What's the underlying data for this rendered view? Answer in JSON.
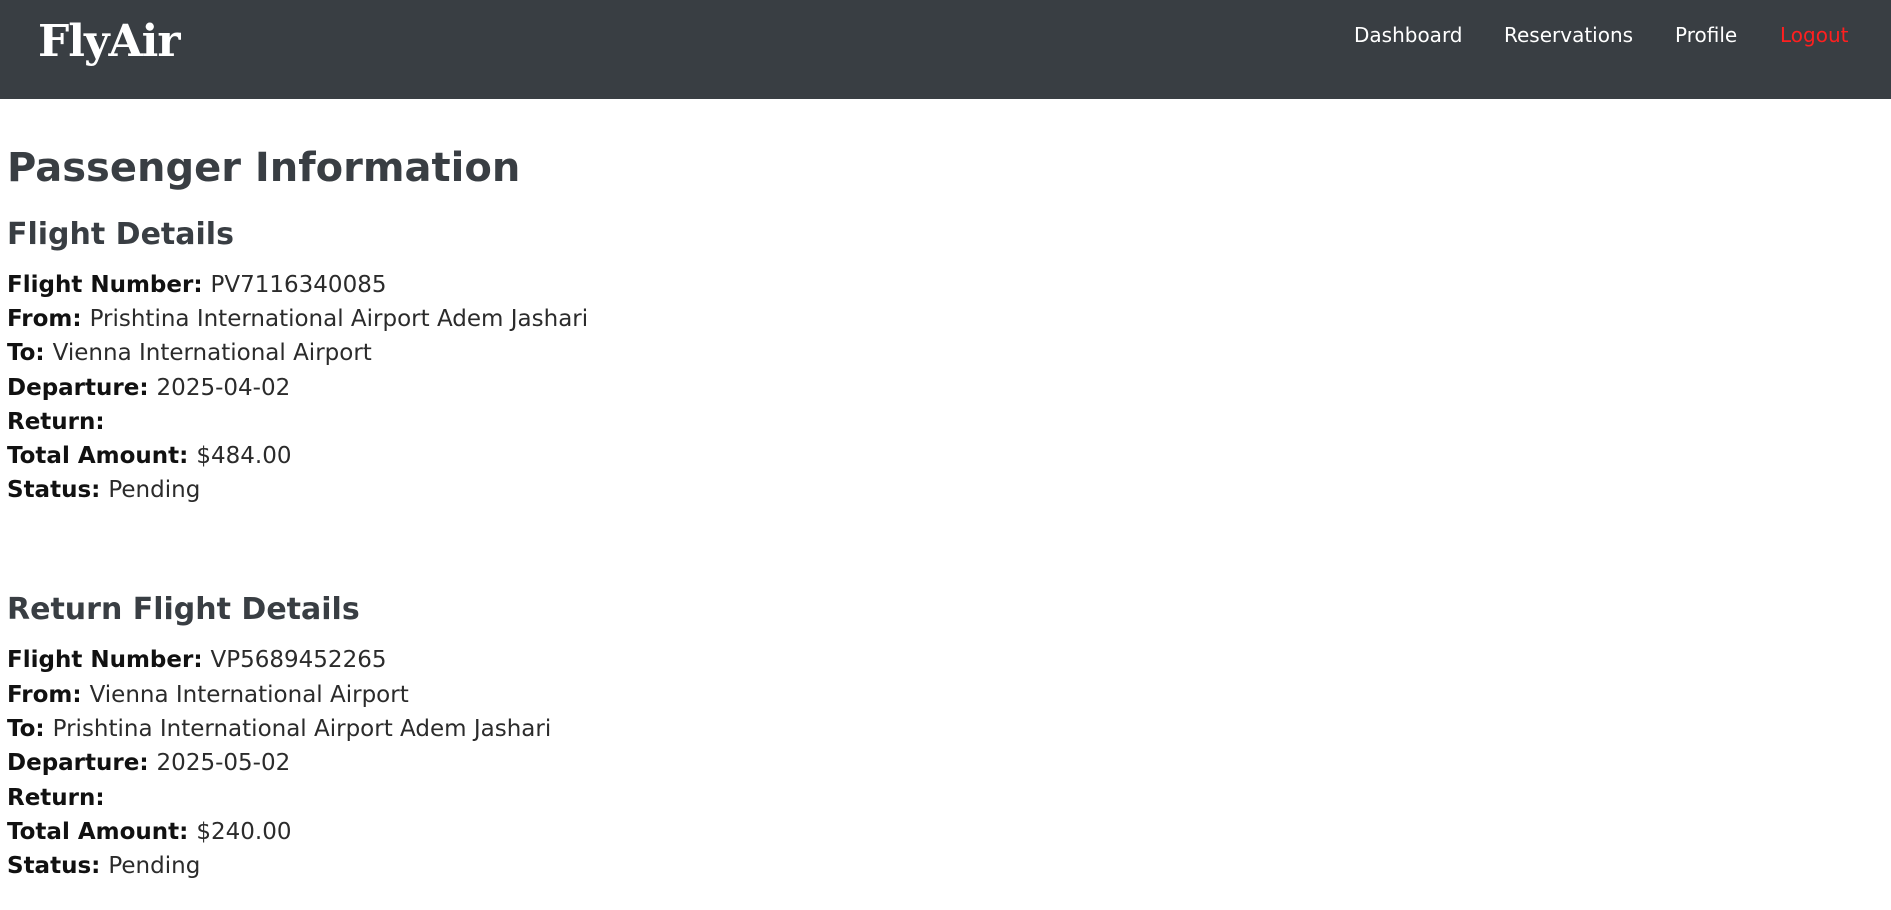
{
  "header": {
    "brand": "FlyAir",
    "nav": {
      "dashboard": "Dashboard",
      "reservations": "Reservations",
      "profile": "Profile",
      "logout": "Logout"
    }
  },
  "page_title": "Passenger Information",
  "flight": {
    "title": "Flight Details",
    "flight_number": {
      "label": "Flight Number:",
      "value": "PV7116340085"
    },
    "from": {
      "label": "From:",
      "value": "Prishtina International Airport Adem Jashari"
    },
    "to": {
      "label": "To:",
      "value": "Vienna International Airport"
    },
    "departure": {
      "label": "Departure:",
      "value": "2025-04-02"
    },
    "return": {
      "label": "Return:",
      "value": ""
    },
    "total_amount": {
      "label": "Total Amount:",
      "value": "$484.00"
    },
    "status": {
      "label": "Status:",
      "value": "Pending"
    }
  },
  "return_flight": {
    "title": "Return Flight Details",
    "flight_number": {
      "label": "Flight Number:",
      "value": "VP5689452265"
    },
    "from": {
      "label": "From:",
      "value": "Vienna International Airport"
    },
    "to": {
      "label": "To:",
      "value": "Prishtina International Airport Adem Jashari"
    },
    "departure": {
      "label": "Departure:",
      "value": "2025-05-02"
    },
    "return": {
      "label": "Return:",
      "value": ""
    },
    "total_amount": {
      "label": "Total Amount:",
      "value": "$240.00"
    },
    "status": {
      "label": "Status:",
      "value": "Pending"
    }
  },
  "colors": {
    "navbar_bg": "#393e43",
    "heading": "#393e43",
    "logout": "#ff1f1f"
  }
}
